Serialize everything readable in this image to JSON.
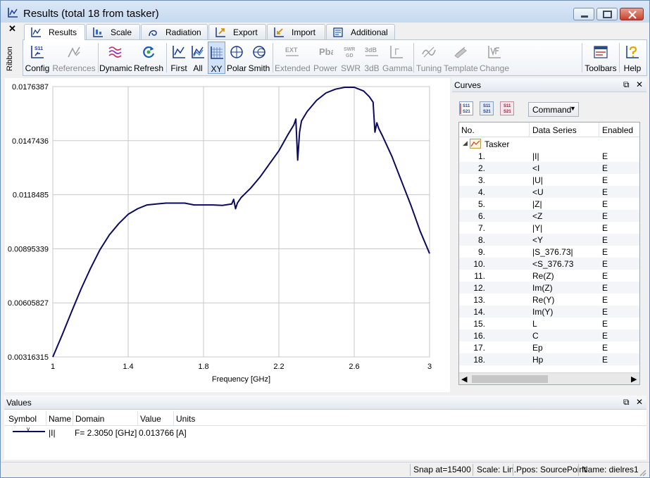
{
  "window": {
    "title": "Results (total 18 from tasker)"
  },
  "ribbon": {
    "collapse_glyph": "✕",
    "side_label": "Ribbon",
    "tabs": [
      {
        "label": "Results",
        "active": true,
        "icon": "results-icon"
      },
      {
        "label": "Scale",
        "active": false,
        "icon": "scale-icon"
      },
      {
        "label": "Radiation",
        "active": false,
        "icon": "radiation-icon"
      },
      {
        "label": "Export",
        "active": false,
        "icon": "export-icon"
      },
      {
        "label": "Import",
        "active": false,
        "icon": "import-icon"
      },
      {
        "label": "Additional",
        "active": false,
        "icon": "additional-icon"
      }
    ],
    "buttons": {
      "config": "Config",
      "references": "References",
      "dynamic": "Dynamic",
      "refresh": "Refresh",
      "first": "First",
      "all": "All",
      "xy": "XY",
      "polar": "Polar",
      "smith": "Smith",
      "extended": "Extended",
      "power": "Power",
      "swr": "SWR",
      "db3": "3dB",
      "gamma": "Gamma",
      "tuning": "Tuning",
      "template": "Template",
      "change": "Change",
      "toolbars": "Toolbars",
      "help": "Help"
    },
    "icon_text": {
      "config": "S11",
      "extended": "EXT",
      "power": "Pbal",
      "swr_top": "SWR",
      "swr_bottom": "GD",
      "db3": "3dB",
      "gamma": "Γ"
    }
  },
  "chart_data": {
    "type": "line",
    "xlabel": "Frequency [GHz]",
    "ylabel": "",
    "xlim": [
      1,
      3
    ],
    "ylim": [
      0.00316315,
      0.0176387
    ],
    "x_ticks": [
      "1",
      "1.4",
      "1.8",
      "2.2",
      "2.6",
      "3"
    ],
    "y_ticks": [
      "0.0176387",
      "0.0147436",
      "0.0118485",
      "0.00895339",
      "0.00605827",
      "0.00316315"
    ],
    "grid": true,
    "series": [
      {
        "name": "|I|",
        "color": "#0a0a5e",
        "x": [
          1.0,
          1.05,
          1.1,
          1.15,
          1.2,
          1.25,
          1.3,
          1.35,
          1.4,
          1.45,
          1.5,
          1.55,
          1.6,
          1.65,
          1.7,
          1.75,
          1.8,
          1.85,
          1.9,
          1.95,
          1.96,
          1.97,
          1.98,
          2.0,
          2.05,
          2.1,
          2.15,
          2.2,
          2.25,
          2.28,
          2.29,
          2.3,
          2.31,
          2.32,
          2.35,
          2.4,
          2.45,
          2.5,
          2.55,
          2.6,
          2.65,
          2.68,
          2.7,
          2.71,
          2.72,
          2.73,
          2.75,
          2.8,
          2.85,
          2.9,
          2.95,
          3.0
        ],
        "y": [
          0.00316,
          0.00435,
          0.0056,
          0.0068,
          0.0079,
          0.0089,
          0.0097,
          0.0103,
          0.0108,
          0.0111,
          0.0113,
          0.01135,
          0.0114,
          0.0114,
          0.0114,
          0.0113,
          0.0113,
          0.0113,
          0.01128,
          0.01135,
          0.0116,
          0.0111,
          0.0114,
          0.0117,
          0.0122,
          0.0128,
          0.0135,
          0.0142,
          0.0151,
          0.0156,
          0.0159,
          0.0137,
          0.0152,
          0.0158,
          0.0163,
          0.0169,
          0.0173,
          0.0175,
          0.0176,
          0.0176,
          0.0174,
          0.0171,
          0.0168,
          0.0152,
          0.0157,
          0.0154,
          0.015,
          0.0139,
          0.0126,
          0.0113,
          0.0099,
          0.0087
        ]
      }
    ]
  },
  "curves": {
    "title": "Curves",
    "command_label": "Command",
    "tool_icons": [
      "s11-s21-icon",
      "s11-s21-alt-icon",
      "s11-s21-red-icon"
    ],
    "tool_text": {
      "top": "S11",
      "bottom": "S21"
    },
    "columns": [
      "No.",
      "Data Series",
      "Enabled"
    ],
    "group": "Tasker",
    "rows": [
      {
        "no": "1.",
        "series": "|I|",
        "enabled": "E"
      },
      {
        "no": "2.",
        "series": "<I",
        "enabled": "E"
      },
      {
        "no": "3.",
        "series": "|U|",
        "enabled": "E"
      },
      {
        "no": "4.",
        "series": "<U",
        "enabled": "E"
      },
      {
        "no": "5.",
        "series": "|Z|",
        "enabled": "E"
      },
      {
        "no": "6.",
        "series": "<Z",
        "enabled": "E"
      },
      {
        "no": "7.",
        "series": "|Y|",
        "enabled": "E"
      },
      {
        "no": "8.",
        "series": "<Y",
        "enabled": "E"
      },
      {
        "no": "9.",
        "series": "|S_376.73|",
        "enabled": "E"
      },
      {
        "no": "10.",
        "series": "<S_376.73",
        "enabled": "E"
      },
      {
        "no": "11.",
        "series": "Re(Z)",
        "enabled": "E"
      },
      {
        "no": "12.",
        "series": "Im(Z)",
        "enabled": "E"
      },
      {
        "no": "13.",
        "series": "Re(Y)",
        "enabled": "E"
      },
      {
        "no": "14.",
        "series": "Im(Y)",
        "enabled": "E"
      },
      {
        "no": "15.",
        "series": "L",
        "enabled": "E"
      },
      {
        "no": "16.",
        "series": "C",
        "enabled": "E"
      },
      {
        "no": "17.",
        "series": "Ep",
        "enabled": "E"
      },
      {
        "no": "18.",
        "series": "Hp",
        "enabled": "E"
      }
    ]
  },
  "values": {
    "title": "Values",
    "columns": [
      "Symbol",
      "Name",
      "Domain",
      "Value",
      "Units"
    ],
    "row": {
      "marker": "v",
      "name": "|I|",
      "domain": "F=  2.3050 [GHz]",
      "value": "0.013766",
      "units": "[A]"
    }
  },
  "panel_controls": {
    "float": "⧉",
    "close": "✕"
  },
  "statusbar": {
    "snap": "Snap at=15400",
    "scale": "Scale: Lin.",
    "ppos": "Ppos: SourcePoint",
    "name": "Name: dielres1"
  }
}
